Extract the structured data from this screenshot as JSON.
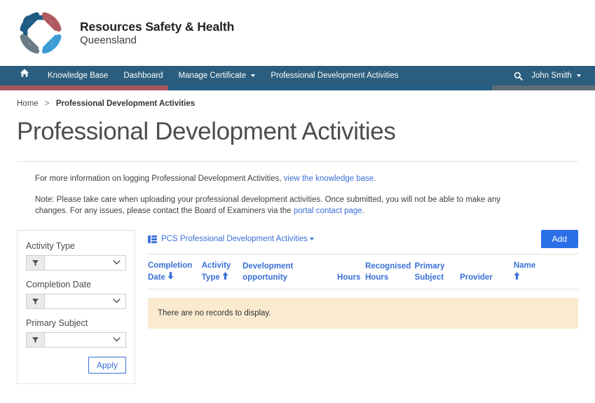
{
  "brand": {
    "logo_name": "rshq-diamond-logo",
    "line1": "Resources Safety & Health",
    "line2": "Queensland",
    "colors": {
      "logo_dark_blue": "#1f5c84",
      "logo_red": "#b05a5f",
      "logo_grey": "#6b7b85",
      "logo_light_blue": "#3c9cd4"
    }
  },
  "nav": {
    "home_icon": "home-icon",
    "items": [
      {
        "label": "Knowledge Base",
        "has_caret": false
      },
      {
        "label": "Dashboard",
        "has_caret": false
      },
      {
        "label": "Manage Certificate",
        "has_caret": true
      },
      {
        "label": "Professional Development Activities",
        "has_caret": false
      }
    ],
    "search_icon": "search-icon",
    "user": "John Smith",
    "bar_color": "#2b5e7e"
  },
  "stripe": {
    "red": "#a8555c",
    "blue": "#235d83",
    "grey": "#5e6f79"
  },
  "breadcrumb": {
    "home": "Home",
    "separator": ">",
    "current": "Professional Development Activities"
  },
  "page": {
    "title": "Professional Development Activities"
  },
  "info": {
    "paragraph1_pre": "For more information on logging Professional Development Activities, ",
    "paragraph1_link": "view the knowledge base",
    "paragraph1_post": ".",
    "paragraph2_pre": "Note: Please take care when uploading your professional development activities. Once submitted, you will not be able to make any changes. For any issues, please contact the Board of Examiners via the ",
    "paragraph2_link": "portal contact page",
    "paragraph2_post": ".",
    "link_color": "#3a6fd8"
  },
  "filters": {
    "groups": [
      {
        "label": "Activity Type",
        "value": "",
        "filter_icon": "funnel-icon"
      },
      {
        "label": "Completion Date",
        "value": "",
        "filter_icon": "funnel-icon"
      },
      {
        "label": "Primary Subject",
        "value": "",
        "filter_icon": "funnel-icon"
      }
    ],
    "apply_label": "Apply"
  },
  "grid": {
    "view_icon": "grid-view-icon",
    "view_name": "PCS Professional Development Activities",
    "add_label": "Add",
    "add_color": "#2b6fe8",
    "columns": [
      {
        "label": "Completion Date",
        "sort": "desc"
      },
      {
        "label": "Activity Type",
        "sort": "asc"
      },
      {
        "label": "Development opportunity",
        "sort": "none"
      },
      {
        "label": "Hours",
        "sort": "none"
      },
      {
        "label": "Recognised Hours",
        "sort": "none"
      },
      {
        "label": "Primary Subject",
        "sort": "none"
      },
      {
        "label": "Provider",
        "sort": "none"
      },
      {
        "label": "Name",
        "sort": "asc"
      }
    ],
    "rows": [],
    "empty_message": "There are no records to display.",
    "empty_bg": "#faebd0"
  }
}
